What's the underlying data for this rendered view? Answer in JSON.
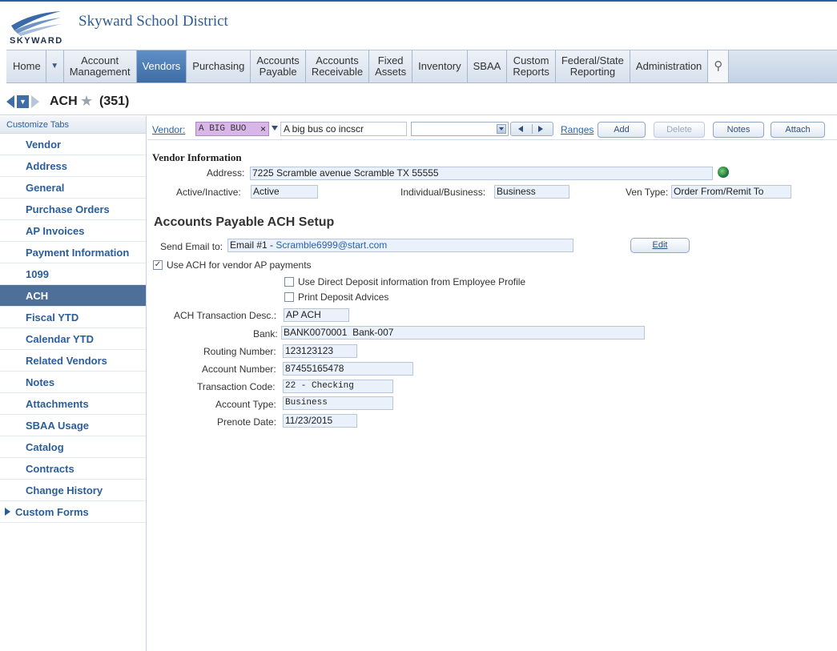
{
  "header": {
    "district_name": "Skyward School District",
    "logo_text": "SKYWARD"
  },
  "nav": {
    "home": "Home",
    "items": [
      {
        "label": "Account\nManagement"
      },
      {
        "label": "Vendors"
      },
      {
        "label": "Purchasing"
      },
      {
        "label": "Accounts\nPayable"
      },
      {
        "label": "Accounts\nReceivable"
      },
      {
        "label": "Fixed\nAssets"
      },
      {
        "label": "Inventory"
      },
      {
        "label": "SBAA"
      },
      {
        "label": "Custom\nReports"
      },
      {
        "label": "Federal/State\nReporting"
      },
      {
        "label": "Administration"
      }
    ],
    "search_icon": "search-icon"
  },
  "title_bar": {
    "title": "ACH",
    "count": "(351)"
  },
  "sidebar": {
    "customize": "Customize Tabs",
    "items": [
      "Vendor",
      "Address",
      "General",
      "Purchase Orders",
      "AP Invoices",
      "Payment Information",
      "1099",
      "ACH",
      "Fiscal YTD",
      "Calendar YTD",
      "Related Vendors",
      "Notes",
      "Attachments",
      "SBAA Usage",
      "Catalog",
      "Contracts",
      "Change History"
    ],
    "custom_forms": "Custom Forms"
  },
  "toolbar": {
    "vendor_label": "Vendor:",
    "vendor_code": "A BIG BUO",
    "vendor_clear": "×",
    "vendor_name": "A big bus co incscr",
    "ranges": "Ranges",
    "add": "Add",
    "delete": "Delete",
    "notes": "Notes",
    "attach": "Attach"
  },
  "vendor_info": {
    "heading": "Vendor Information",
    "address_label": "Address:",
    "address": "7225 Scramble avenue Scramble TX 55555",
    "active_label": "Active/Inactive:",
    "active": "Active",
    "indiv_label": "Individual/Business:",
    "indiv": "Business",
    "ventype_label": "Ven Type:",
    "ventype": "Order From/Remit To"
  },
  "ach": {
    "heading": "Accounts Payable ACH Setup",
    "email_label": "Send Email to:",
    "email_prefix": "Email #1 - ",
    "email": "Scramble6999@start.com",
    "edit": "Edit",
    "use_ach": "Use ACH for vendor AP payments",
    "use_dd": "Use Direct Deposit information from Employee Profile",
    "print_advices": "Print Deposit Advices",
    "desc_label": "ACH Transaction Desc.:",
    "desc": "AP ACH",
    "bank_label": "Bank:",
    "bank_code": "BANK0070001",
    "bank_name": "Bank-007",
    "routing_label": "Routing Number:",
    "routing": "123123123",
    "account_label": "Account Number:",
    "account": "87455165478",
    "txcode_label": "Transaction Code:",
    "txcode": "22 - Checking",
    "accttype_label": "Account Type:",
    "accttype": "Business",
    "prenote_label": "Prenote Date:",
    "prenote": "11/23/2015"
  },
  "colors": {
    "accent": "#2a5d9b",
    "active_tab": "#4d6f98",
    "vendor_chip": "#d8b7e8"
  }
}
